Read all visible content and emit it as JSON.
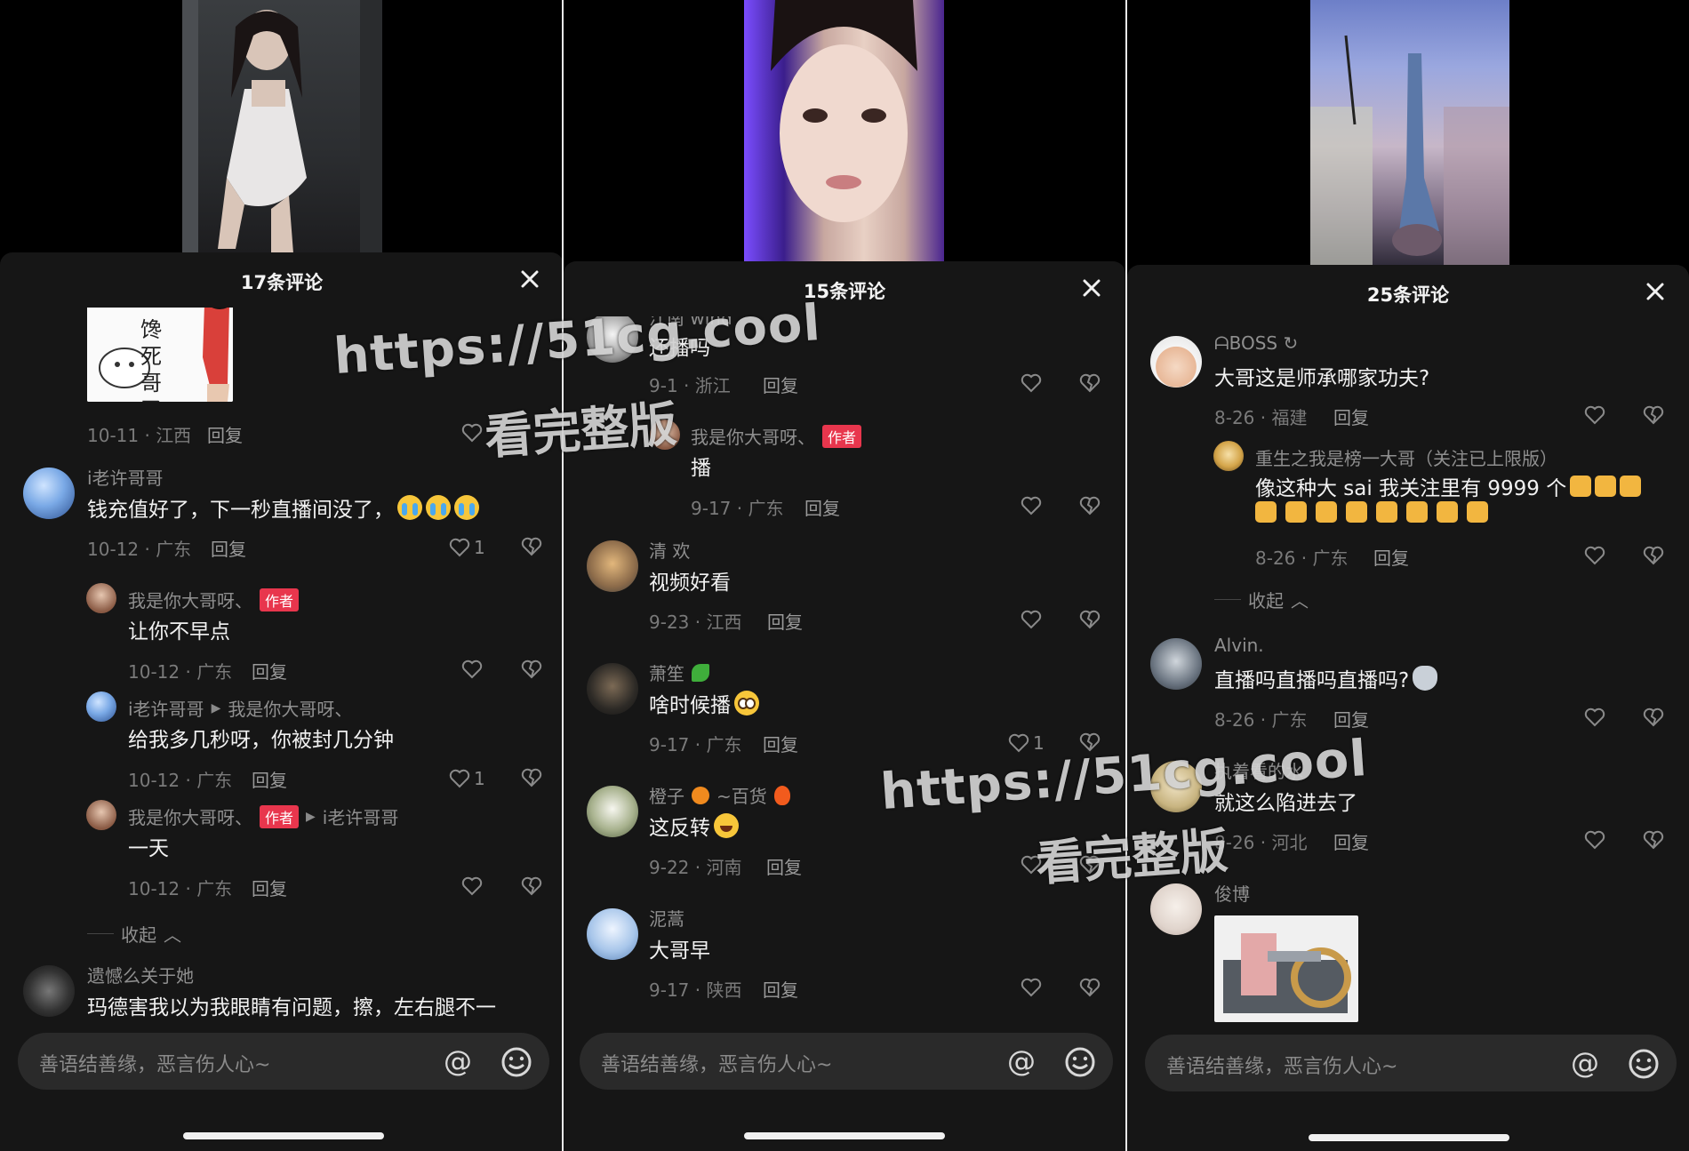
{
  "colors": {
    "panel_bg": "#161616",
    "author_badge": "#e8364d",
    "text_primary": "#f1f1f1",
    "text_secondary": "#8f8f8f"
  },
  "watermark": {
    "url": "https://51cg.cool",
    "text": "看完整版"
  },
  "common": {
    "reply_label": "回复",
    "input_placeholder": "善语结善缘，恶言伤人心~",
    "collapse_label": "收起",
    "author_badge": "作者"
  },
  "phones": [
    {
      "title": "17条评论",
      "comments": [
        {
          "meta": "10-11 · 江西",
          "sticker_text": "馋死哥了",
          "likes": ""
        },
        {
          "user": "i老许哥哥",
          "text": "钱充值好了，下一秒直播间没了，",
          "emojis": [
            "cry",
            "cry",
            "cry"
          ],
          "meta": "10-12 · 广东",
          "likes": "1"
        },
        {
          "user": "我是你大哥呀、",
          "author": true,
          "text": "让你不早点",
          "meta": "10-12 · 广东",
          "likes": "",
          "reply": true
        },
        {
          "user": "i老许哥哥",
          "reply_to": "我是你大哥呀、",
          "text": "给我多几秒呀，你被封几分钟",
          "meta": "10-12 · 广东",
          "likes": "1",
          "reply": true
        },
        {
          "user": "我是你大哥呀、",
          "author": true,
          "reply_to": "i老许哥哥",
          "text": "一天",
          "meta": "10-12 · 广东",
          "likes": "",
          "reply": true
        },
        {
          "user": "遗憾么关于她",
          "text": "玛德害我以为我眼睛有问题，擦，左右腿不一",
          "meta": "",
          "likes": ""
        }
      ]
    },
    {
      "title": "15条评论",
      "comments": [
        {
          "user": "江南 wind",
          "text": "还播吗",
          "meta": "9-1 · 浙江",
          "likes": ""
        },
        {
          "user": "我是你大哥呀、",
          "author": true,
          "text": "播",
          "meta": "9-17 · 广东",
          "likes": "",
          "reply": true
        },
        {
          "user": "清 欢",
          "text": "视频好看",
          "meta": "9-23 · 江西",
          "likes": ""
        },
        {
          "user": "萧笙",
          "user_emoji": "clover",
          "text": "啥时候播",
          "emojis": [
            "plead"
          ],
          "meta": "9-17 · 广东",
          "likes": "1"
        },
        {
          "user": "橙子",
          "user_emoji": "orange",
          "user_suffix": "~百货",
          "user_emoji2": "fire",
          "text": "这反转",
          "emojis": [
            "laugh"
          ],
          "meta": "9-22 · 河南",
          "likes": ""
        },
        {
          "user": "泥蒿",
          "text": "大哥早",
          "meta": "9-17 · 陕西",
          "likes": ""
        }
      ]
    },
    {
      "title": "25条评论",
      "comments": [
        {
          "user": "ᗩBOSS ↻",
          "text": "大哥这是师承哪家功夫?",
          "meta": "8-26 · 福建",
          "likes": ""
        },
        {
          "user": "重生之我是榜一大哥（关注已上限版）",
          "text": "像这种大 sai 我关注里有 9999 个",
          "emojis": [
            "cat",
            "cat",
            "cat"
          ],
          "line2_emojis": [
            "cat",
            "cat",
            "cat",
            "cat",
            "cat",
            "cat",
            "cat",
            "cat"
          ],
          "meta": "8-26 · 广东",
          "likes": "",
          "reply": true
        },
        {
          "user": "Alvin.",
          "text": "直播吗直播吗直播吗?",
          "emojis": [
            "wolf"
          ],
          "meta": "8-26 · 广东",
          "likes": ""
        },
        {
          "user": "执着看的水",
          "text": "就这么陷进去了",
          "meta": "8-26 · 河北",
          "likes": ""
        },
        {
          "user": "俊博",
          "text": "",
          "meta": "",
          "likes": ""
        }
      ]
    }
  ]
}
